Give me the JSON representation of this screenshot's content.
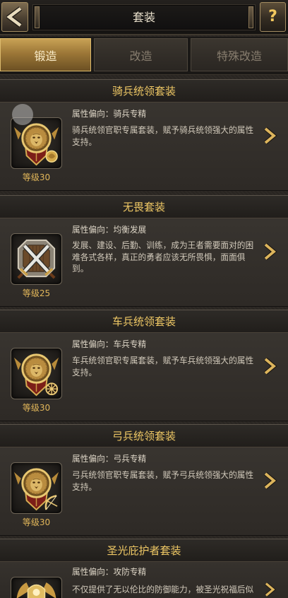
{
  "header": {
    "title": "套装",
    "help_label": "?",
    "back_icon": "back-arrow-icon",
    "help_icon": "question-mark-icon"
  },
  "tabs": [
    {
      "label": "锻造",
      "state": "active"
    },
    {
      "label": "改造",
      "state": "inactive"
    },
    {
      "label": "特殊改造",
      "state": "inactive"
    }
  ],
  "cards": [
    {
      "title": "骑兵统领套装",
      "attribute": "属性偏向：骑兵专精",
      "description": "骑兵统领官职专属套装，赋予骑兵统领强大的属性支持。",
      "level": "等级30",
      "icon": "cavalry-lion-emblem-icon"
    },
    {
      "title": "无畏套装",
      "attribute": "属性偏向：均衡发展",
      "description": "发展、建设、后勤、训练，成为王者需要面对的困难各式各样，真正的勇者应该无所畏惧，面面俱到。",
      "level": "等级25",
      "icon": "crossed-swords-shield-icon"
    },
    {
      "title": "车兵统领套装",
      "attribute": "属性偏向：车兵专精",
      "description": "车兵统领官职专属套装，赋予车兵统领强大的属性支持。",
      "level": "等级30",
      "icon": "chariot-lion-emblem-icon"
    },
    {
      "title": "弓兵统领套装",
      "attribute": "属性偏向：弓兵专精",
      "description": "弓兵统领官职专属套装，赋予弓兵统领强大的属性支持。",
      "level": "等级30",
      "icon": "archer-lion-emblem-icon"
    },
    {
      "title": "圣光庇护者套装",
      "attribute": "属性偏向：攻防专精",
      "description": "不仅提供了无以伦比的防御能力，被圣光祝福后似",
      "icon": "holy-guardian-emblem-icon"
    }
  ],
  "card_arrow_icon": "chevron-right-icon",
  "colors": {
    "background": "#2a2622",
    "title_gold": "#efc865",
    "level_gold": "#e2b75a",
    "body_text": "#d2cabb",
    "active_tab": "#9c7737",
    "inactive_tab_text": "#877d6e"
  }
}
